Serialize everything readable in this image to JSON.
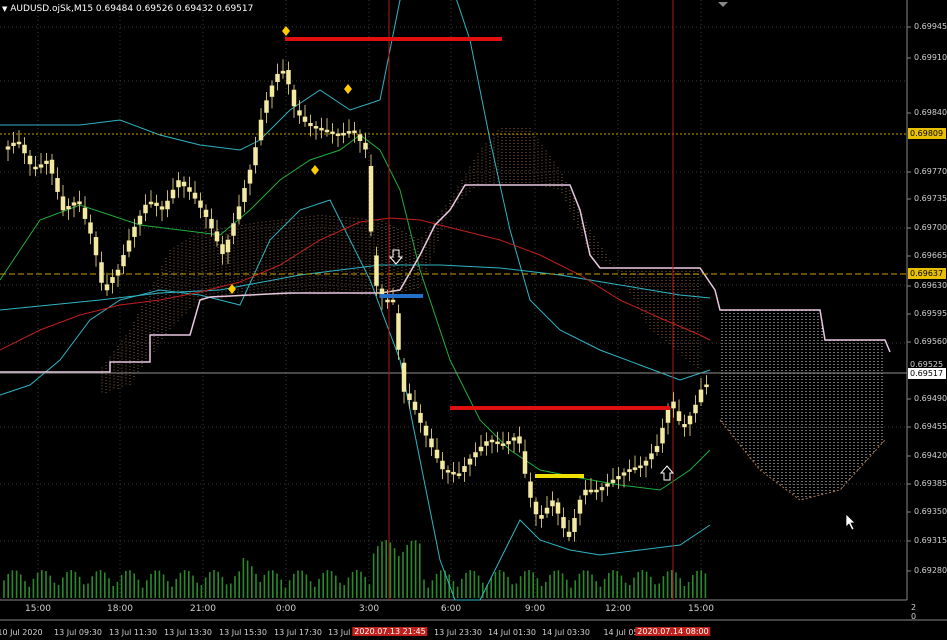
{
  "header": {
    "title": "AUDUSD.ojSk,M15  0.69484 0.69526 0.69432 0.69517"
  },
  "price_axis": {
    "labels": [
      "0.69945",
      "0.69910",
      "0.69840",
      "0.69770",
      "0.69735",
      "0.69700",
      "0.69665",
      "0.69630",
      "0.69595",
      "0.69560",
      "0.69490",
      "0.69455",
      "0.69420",
      "0.69385",
      "0.69350",
      "0.69315",
      "0.69280"
    ],
    "tags": {
      "high_line": "0.69809",
      "dashed_line": "0.69637",
      "current_price": "0.69517",
      "hidden_label_behind_current": "0.69525"
    }
  },
  "volume_axis": {
    "top": "2",
    "bottom": "0"
  },
  "time_axis": {
    "hours": [
      "15:00",
      "18:00",
      "21:00",
      "0:00",
      "3:00",
      "6:00",
      "9:00",
      "12:00",
      "15:00"
    ],
    "dates": [
      "10 Jul 2020",
      "13 Jul 09:30",
      "13 Jul 11:30",
      "13 Jul 13:30",
      "13 Jul 15:30",
      "13 Jul 17:30",
      "13 Jul 1",
      "13 Jul 23:30",
      "14 Jul 01:30",
      "14 Jul 03:30",
      "14 Jul 05"
    ],
    "highlighted_dates": [
      "2020.07.13 21:45",
      "2020.07.14 08:00"
    ]
  },
  "colors": {
    "background": "#000000",
    "candle_up": "#f4e9a1",
    "bollinger": "#2fb4c4",
    "ma_fast": "#1fae3a",
    "ma_slow": "#c0201c",
    "kijun": "#e8c8e0",
    "cloud": "#b07a50",
    "resistance": "#e01010",
    "support": "#f0e000",
    "signal_blue": "#2470c8",
    "volume": "#2a8a2a",
    "vline": "#b01818",
    "fractal": "#ffcc00"
  },
  "icons": {
    "down_arrow": "arrow-down-icon",
    "up_arrow": "arrow-up-icon",
    "cursor": "mouse-cursor-icon",
    "fractal": "diamond-icon"
  }
}
